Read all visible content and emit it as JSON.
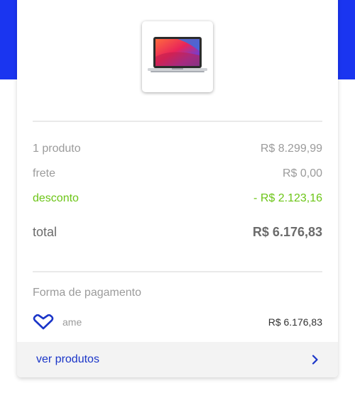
{
  "colors": {
    "brand_blue": "#1a35f0",
    "discount_green": "#6cc517",
    "link_blue": "#1a35c8"
  },
  "product": {
    "image_icon": "laptop-icon"
  },
  "summary": {
    "items_label": "1 produto",
    "items_value": "R$ 8.299,99",
    "shipping_label": "frete",
    "shipping_value": "R$ 0,00",
    "discount_label": "desconto",
    "discount_value": "- R$ 2.123,16",
    "total_label": "total",
    "total_value": "R$ 6.176,83"
  },
  "payment": {
    "section_title": "Forma de pagamento",
    "method_icon": "ame-heart-icon",
    "method_name": "ame",
    "amount": "R$ 6.176,83"
  },
  "footer": {
    "label": "ver produtos",
    "chevron_icon": "chevron-right-icon"
  }
}
